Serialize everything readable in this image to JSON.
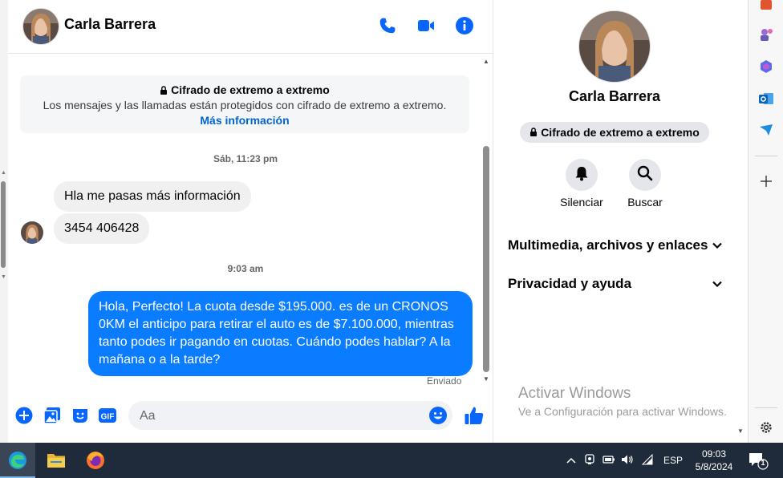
{
  "contact": {
    "name": "Carla Barrera"
  },
  "encryption": {
    "title": "Cifrado de extremo a extremo",
    "description": "Los mensajes y las llamadas están protegidos con cifrado de extremo a extremo.",
    "link": "Más información"
  },
  "messages": {
    "timestamp_1": "Sáb, 11:23 pm",
    "incoming_1": "Hla me pasas más información",
    "incoming_2": "3454 406428",
    "timestamp_2": "9:03 am",
    "outgoing_1": "Hola, Perfecto! La cuota desde $195.000. es de un CRONOS 0KM el anticipo para retirar el auto es de $7.100.000, mientras tanto podes ir pagando en cuotas. Cuándo podes hablar? A la mañana o a la tarde?",
    "status": "Enviado"
  },
  "composer": {
    "placeholder": "Aa",
    "gif_label": "GIF"
  },
  "profile": {
    "badge": "Cifrado de extremo a extremo",
    "actions": [
      {
        "label": "Silenciar",
        "icon": "bell-icon"
      },
      {
        "label": "Buscar",
        "icon": "search-icon"
      }
    ],
    "sections": [
      {
        "label": "Multimedia, archivos y enlaces"
      },
      {
        "label": "Privacidad y ayuda"
      }
    ]
  },
  "watermark": {
    "title": "Activar Windows",
    "subtitle": "Ve a Configuración para activar Windows."
  },
  "taskbar": {
    "language": "ESP",
    "time": "09:03",
    "date": "5/8/2024",
    "notification_count": "1"
  },
  "colors": {
    "messenger_blue": "#0a7cff",
    "link_blue": "#0064d1",
    "icon_blue": "#0866ff",
    "taskbar": "#1f2b3a"
  }
}
